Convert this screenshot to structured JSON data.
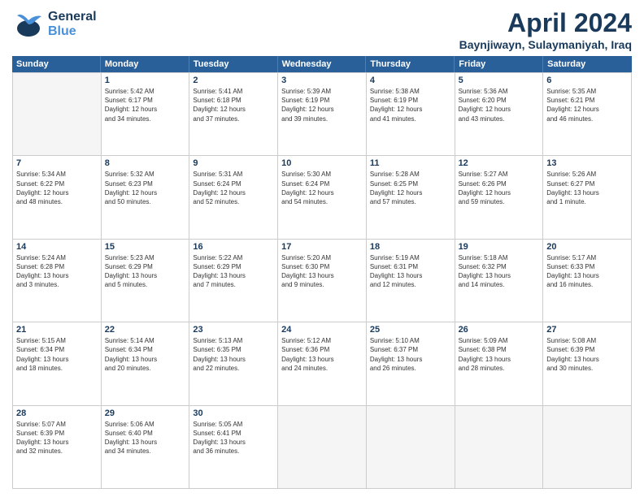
{
  "header": {
    "logo_general": "General",
    "logo_blue": "Blue",
    "month_title": "April 2024",
    "location": "Baynjiwayn, Sulaymaniyah, Iraq"
  },
  "days_of_week": [
    "Sunday",
    "Monday",
    "Tuesday",
    "Wednesday",
    "Thursday",
    "Friday",
    "Saturday"
  ],
  "weeks": [
    [
      {
        "day": "",
        "info": ""
      },
      {
        "day": "1",
        "info": "Sunrise: 5:42 AM\nSunset: 6:17 PM\nDaylight: 12 hours\nand 34 minutes."
      },
      {
        "day": "2",
        "info": "Sunrise: 5:41 AM\nSunset: 6:18 PM\nDaylight: 12 hours\nand 37 minutes."
      },
      {
        "day": "3",
        "info": "Sunrise: 5:39 AM\nSunset: 6:19 PM\nDaylight: 12 hours\nand 39 minutes."
      },
      {
        "day": "4",
        "info": "Sunrise: 5:38 AM\nSunset: 6:19 PM\nDaylight: 12 hours\nand 41 minutes."
      },
      {
        "day": "5",
        "info": "Sunrise: 5:36 AM\nSunset: 6:20 PM\nDaylight: 12 hours\nand 43 minutes."
      },
      {
        "day": "6",
        "info": "Sunrise: 5:35 AM\nSunset: 6:21 PM\nDaylight: 12 hours\nand 46 minutes."
      }
    ],
    [
      {
        "day": "7",
        "info": "Sunrise: 5:34 AM\nSunset: 6:22 PM\nDaylight: 12 hours\nand 48 minutes."
      },
      {
        "day": "8",
        "info": "Sunrise: 5:32 AM\nSunset: 6:23 PM\nDaylight: 12 hours\nand 50 minutes."
      },
      {
        "day": "9",
        "info": "Sunrise: 5:31 AM\nSunset: 6:24 PM\nDaylight: 12 hours\nand 52 minutes."
      },
      {
        "day": "10",
        "info": "Sunrise: 5:30 AM\nSunset: 6:24 PM\nDaylight: 12 hours\nand 54 minutes."
      },
      {
        "day": "11",
        "info": "Sunrise: 5:28 AM\nSunset: 6:25 PM\nDaylight: 12 hours\nand 57 minutes."
      },
      {
        "day": "12",
        "info": "Sunrise: 5:27 AM\nSunset: 6:26 PM\nDaylight: 12 hours\nand 59 minutes."
      },
      {
        "day": "13",
        "info": "Sunrise: 5:26 AM\nSunset: 6:27 PM\nDaylight: 13 hours\nand 1 minute."
      }
    ],
    [
      {
        "day": "14",
        "info": "Sunrise: 5:24 AM\nSunset: 6:28 PM\nDaylight: 13 hours\nand 3 minutes."
      },
      {
        "day": "15",
        "info": "Sunrise: 5:23 AM\nSunset: 6:29 PM\nDaylight: 13 hours\nand 5 minutes."
      },
      {
        "day": "16",
        "info": "Sunrise: 5:22 AM\nSunset: 6:29 PM\nDaylight: 13 hours\nand 7 minutes."
      },
      {
        "day": "17",
        "info": "Sunrise: 5:20 AM\nSunset: 6:30 PM\nDaylight: 13 hours\nand 9 minutes."
      },
      {
        "day": "18",
        "info": "Sunrise: 5:19 AM\nSunset: 6:31 PM\nDaylight: 13 hours\nand 12 minutes."
      },
      {
        "day": "19",
        "info": "Sunrise: 5:18 AM\nSunset: 6:32 PM\nDaylight: 13 hours\nand 14 minutes."
      },
      {
        "day": "20",
        "info": "Sunrise: 5:17 AM\nSunset: 6:33 PM\nDaylight: 13 hours\nand 16 minutes."
      }
    ],
    [
      {
        "day": "21",
        "info": "Sunrise: 5:15 AM\nSunset: 6:34 PM\nDaylight: 13 hours\nand 18 minutes."
      },
      {
        "day": "22",
        "info": "Sunrise: 5:14 AM\nSunset: 6:34 PM\nDaylight: 13 hours\nand 20 minutes."
      },
      {
        "day": "23",
        "info": "Sunrise: 5:13 AM\nSunset: 6:35 PM\nDaylight: 13 hours\nand 22 minutes."
      },
      {
        "day": "24",
        "info": "Sunrise: 5:12 AM\nSunset: 6:36 PM\nDaylight: 13 hours\nand 24 minutes."
      },
      {
        "day": "25",
        "info": "Sunrise: 5:10 AM\nSunset: 6:37 PM\nDaylight: 13 hours\nand 26 minutes."
      },
      {
        "day": "26",
        "info": "Sunrise: 5:09 AM\nSunset: 6:38 PM\nDaylight: 13 hours\nand 28 minutes."
      },
      {
        "day": "27",
        "info": "Sunrise: 5:08 AM\nSunset: 6:39 PM\nDaylight: 13 hours\nand 30 minutes."
      }
    ],
    [
      {
        "day": "28",
        "info": "Sunrise: 5:07 AM\nSunset: 6:39 PM\nDaylight: 13 hours\nand 32 minutes."
      },
      {
        "day": "29",
        "info": "Sunrise: 5:06 AM\nSunset: 6:40 PM\nDaylight: 13 hours\nand 34 minutes."
      },
      {
        "day": "30",
        "info": "Sunrise: 5:05 AM\nSunset: 6:41 PM\nDaylight: 13 hours\nand 36 minutes."
      },
      {
        "day": "",
        "info": ""
      },
      {
        "day": "",
        "info": ""
      },
      {
        "day": "",
        "info": ""
      },
      {
        "day": "",
        "info": ""
      }
    ]
  ]
}
